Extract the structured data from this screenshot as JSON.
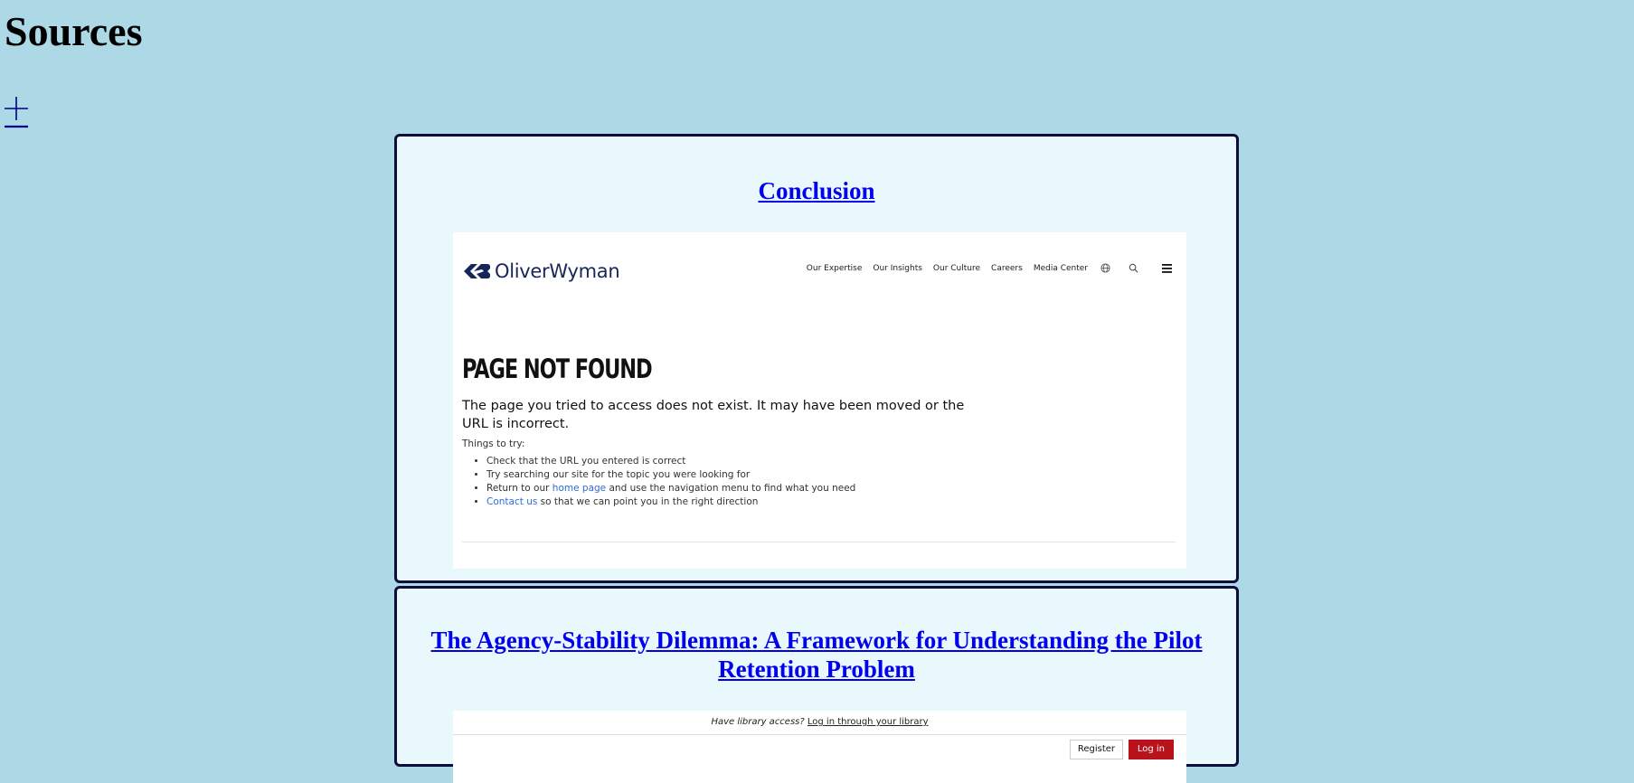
{
  "page": {
    "title": "Sources",
    "add_icon": "plus-icon"
  },
  "colors": {
    "background": "#add8e6",
    "card_background": "#e8f8fc",
    "card_border": "#0d0d3a",
    "link": "#0000ee",
    "login_button": "#b8121b"
  },
  "sources": [
    {
      "title": "Conclusion",
      "screenshot": {
        "logo_text": "OliverWyman",
        "logo_icon": "oliverwyman-logo-icon",
        "nav": [
          "Our Expertise",
          "Our Insights",
          "Our Culture",
          "Careers",
          "Media Center"
        ],
        "nav_icons": [
          "globe-icon",
          "search-icon",
          "menu-icon"
        ],
        "heading": "PAGE NOT FOUND",
        "lead": "The page you tried to access does not exist. It may have been moved or the URL is incorrect.",
        "things_label": "Things to try:",
        "items": {
          "item1": "Check that the URL you entered is correct",
          "item2": "Try searching our site for the topic you were looking for",
          "item3_before": "Return to our ",
          "item3_link": "home page",
          "item3_after": " and use the navigation menu to find what you need",
          "item4_link": "Contact us",
          "item4_after": " so that we can point you in the right direction"
        }
      }
    },
    {
      "title": "The Agency-Stability Dilemma: A Framework for Understanding the Pilot Retention Problem",
      "screenshot": {
        "library_question": "Have library access?",
        "library_link": "Log in through your library",
        "register": "Register",
        "login": "Log in"
      }
    }
  ]
}
